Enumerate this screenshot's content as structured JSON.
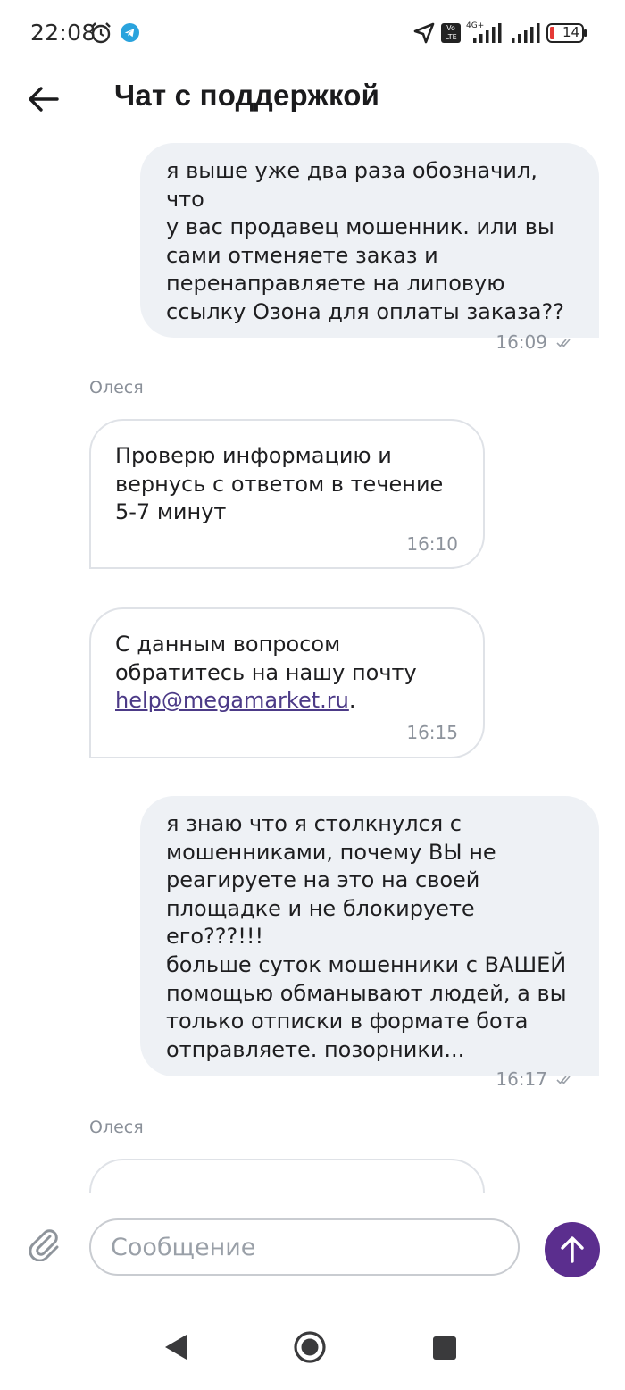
{
  "status_bar": {
    "time": "22:08",
    "network": "4G+",
    "battery": "14",
    "icons": [
      "alarm-icon",
      "telegram-icon",
      "location-icon",
      "volte-icon",
      "signal-icon",
      "signal-icon",
      "battery-icon"
    ]
  },
  "header": {
    "title": "Чат с поддержкой",
    "back_icon": "arrow-left-icon"
  },
  "messages": [
    {
      "direction": "outgoing",
      "text": "я выше уже два раза обозначил, что\nу вас продавец мошенник. или вы\nсами отменяете заказ и\nперенаправляете на липовую\nссылку Озона для оплаты заказа??",
      "time": "16:09",
      "status": "read"
    },
    {
      "direction": "incoming",
      "sender": "Олеся",
      "text": "Проверю информацию и\nвернусь с ответом в течение\n5-7 минут",
      "time": "16:10"
    },
    {
      "direction": "incoming",
      "text_before": "С данным вопросом\nобратитесь на нашу почту\n",
      "link": "help@megamarket.ru",
      "text_after": ".",
      "time": "16:15"
    },
    {
      "direction": "outgoing",
      "text": "я знаю что я столкнулся с\nмошенниками, почему ВЫ не\nреагируете на это на своей\nплощадке и не блокируете его???!!!\nбольше суток мошенники с ВАШЕЙ\nпомощью обманывают людей, а вы\nтолько отписки в формате бота\nотправляете. позорники...",
      "time": "16:17",
      "status": "read"
    },
    {
      "direction": "incoming",
      "sender": "Олеся",
      "text": "",
      "partially_visible": true
    }
  ],
  "composer": {
    "placeholder": "Сообщение",
    "attach_icon": "paperclip-icon",
    "send_icon": "arrow-up-icon",
    "send_color": "#5b2e8e"
  },
  "nav_bar": {
    "icons": [
      "nav-back-icon",
      "nav-home-icon",
      "nav-recents-icon"
    ]
  },
  "colors": {
    "outgoing_bubble": "#eef1f5",
    "incoming_border": "#dfe2e7",
    "link": "#4c3a87",
    "accent": "#5b2e8e"
  }
}
